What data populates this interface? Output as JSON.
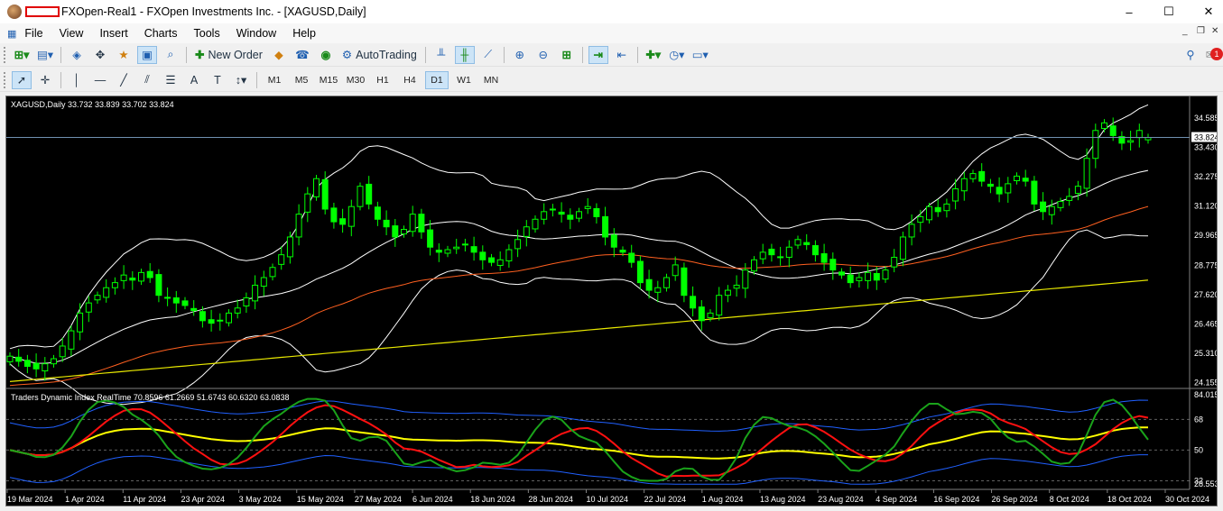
{
  "window": {
    "title": "FXOpen-Real1 - FXOpen Investments Inc. - [XAGUSD,Daily]",
    "minimize": "–",
    "maximize": "☐",
    "close": "✕"
  },
  "menu": [
    "File",
    "View",
    "Insert",
    "Charts",
    "Tools",
    "Window",
    "Help"
  ],
  "toolbar": {
    "new_order": "New Order",
    "autotrading": "AutoTrading",
    "notification_count": "1"
  },
  "timeframes": [
    "M1",
    "M5",
    "M15",
    "M30",
    "H1",
    "H4",
    "D1",
    "W1",
    "MN"
  ],
  "active_timeframe": "D1",
  "chart": {
    "header": "XAGUSD,Daily  33.732 33.839 33.702 33.824",
    "price_axis": [
      "34.585",
      "33.430",
      "32.275",
      "31.120",
      "29.965",
      "28.775",
      "27.620",
      "26.465",
      "25.310",
      "24.155"
    ],
    "current_price": "33.824",
    "indicator_header": "Traders Dynamic Index RealTime 70.8596 61.2669 51.6743 60.6320 63.0838",
    "indicator_axis": [
      "84.0158",
      "68",
      "50",
      "32",
      "28.5535"
    ],
    "date_axis": [
      "19 Mar 2024",
      "1 Apr 2024",
      "11 Apr 2024",
      "23 Apr 2024",
      "3 May 2024",
      "15 May 2024",
      "27 May 2024",
      "6 Jun 2024",
      "18 Jun 2024",
      "28 Jun 2024",
      "10 Jul 2024",
      "22 Jul 2024",
      "1 Aug 2024",
      "13 Aug 2024",
      "23 Aug 2024",
      "4 Sep 2024",
      "16 Sep 2024",
      "26 Sep 2024",
      "8 Oct 2024",
      "18 Oct 2024",
      "30 Oct 2024"
    ],
    "colors": {
      "bg": "#000000",
      "candle": "#00ff00",
      "bollinger": "#ffffff",
      "ma_mid": "#ff6020",
      "ma_long": "#e8e800",
      "tdi_green": "#1aa31a",
      "tdi_red": "#ff1010",
      "tdi_yellow": "#ffff00",
      "tdi_blue": "#2060ff"
    }
  },
  "chart_data": {
    "type": "candlestick",
    "symbol": "XAGUSD",
    "timeframe": "Daily",
    "ohlc_last": {
      "open": 33.732,
      "high": 33.839,
      "low": 33.702,
      "close": 33.824
    },
    "close": [
      25.2,
      25.0,
      24.8,
      24.7,
      24.9,
      25.1,
      25.6,
      26.2,
      26.9,
      27.3,
      27.6,
      27.9,
      28.1,
      28.4,
      28.2,
      28.5,
      28.3,
      27.6,
      27.5,
      27.3,
      27.2,
      27.0,
      26.6,
      26.5,
      26.6,
      26.9,
      27.1,
      27.5,
      28.0,
      28.3,
      28.7,
      29.2,
      29.9,
      30.8,
      31.6,
      32.2,
      31.0,
      30.5,
      30.4,
      31.1,
      31.9,
      31.2,
      30.6,
      30.3,
      29.9,
      30.2,
      30.8,
      30.1,
      29.5,
      29.3,
      29.4,
      29.5,
      29.6,
      29.3,
      29.0,
      28.9,
      29.0,
      29.4,
      29.8,
      30.3,
      30.6,
      30.9,
      31.0,
      30.8,
      30.6,
      30.9,
      31.1,
      30.7,
      29.9,
      29.5,
      29.3,
      28.9,
      28.1,
      27.8,
      27.9,
      28.3,
      28.8,
      27.6,
      27.1,
      26.6,
      26.9,
      27.6,
      27.8,
      28.0,
      28.6,
      29.0,
      29.3,
      29.2,
      29.1,
      29.5,
      29.8,
      29.6,
      29.2,
      28.9,
      28.6,
      28.4,
      28.1,
      28.3,
      28.5,
      28.2,
      28.6,
      29.1,
      29.9,
      30.4,
      30.7,
      31.1,
      30.9,
      31.2,
      31.8,
      32.2,
      32.4,
      32.1,
      31.9,
      31.6,
      32.0,
      32.3,
      32.1,
      31.2,
      30.9,
      31.1,
      31.3,
      31.5,
      31.9,
      33.0,
      34.1,
      34.4,
      33.9,
      33.6,
      33.7,
      34.1,
      33.824
    ],
    "title": "XAGUSD,Daily"
  }
}
